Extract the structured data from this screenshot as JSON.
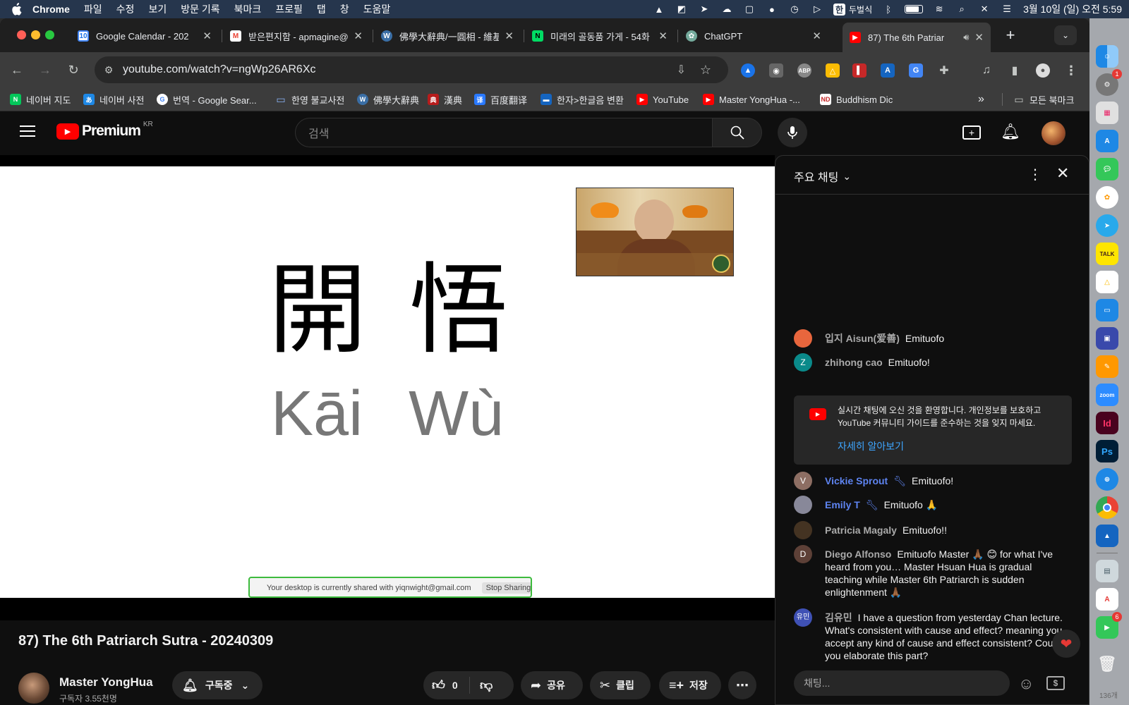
{
  "menubar": {
    "app": "Chrome",
    "items": [
      "파일",
      "수정",
      "보기",
      "방문 기록",
      "북마크",
      "프로필",
      "탭",
      "창",
      "도움말"
    ],
    "input_mode": "한",
    "input_name": "두벌식",
    "clock": "3월 10일 (일) 오전 5:59"
  },
  "tabs": [
    {
      "title": "Google Calendar - 202",
      "favicon": "calendar-icon",
      "badge": "10"
    },
    {
      "title": "받은편지함 - apmagine@",
      "favicon": "gmail-icon"
    },
    {
      "title": "佛學大辭典/一圓相 - 維基",
      "favicon": "wiki-icon"
    },
    {
      "title": "미래의 골동품 가게 - 54화",
      "favicon": "webtoon-icon"
    },
    {
      "title": "ChatGPT",
      "favicon": "chatgpt-icon"
    },
    {
      "title": "87) The 6th Patriar",
      "favicon": "youtube-icon",
      "active": true
    }
  ],
  "address": "youtube.com/watch?v=ngWp26AR6Xc",
  "bookmarks": [
    {
      "label": "네이버 지도"
    },
    {
      "label": "네이버 사전"
    },
    {
      "label": "번역 - Google Sear..."
    },
    {
      "label": "한영 불교사전"
    },
    {
      "label": "佛學大辭典"
    },
    {
      "label": "漢典"
    },
    {
      "label": "百度翻译"
    },
    {
      "label": "한자>한글음 변환"
    },
    {
      "label": "YouTube"
    },
    {
      "label": "Master YongHua -..."
    },
    {
      "label": "Buddhism Dic"
    }
  ],
  "bookmarks_all": "모든 북마크",
  "youtube": {
    "logo_text": "Premium",
    "region": "KR",
    "search_placeholder": "검색"
  },
  "slide": {
    "chars": "開悟",
    "pinyin": "Kāi Wù",
    "share_notice": "Your desktop is currently shared with yiqnwight@gmail.com",
    "stop_sharing": "Stop Sharing"
  },
  "video": {
    "title": "87) The 6th Patriarch Sutra - 20240309",
    "channel": "Master YongHua",
    "subscribers": "구독자 3.55천명",
    "subscribed_label": "구독중",
    "likes": "0",
    "share_label": "공유",
    "clip_label": "클립",
    "save_label": "저장"
  },
  "chat": {
    "header": "주요 채팅",
    "notice_text": "실시간 채팅에 오신 것을 환영합니다. 개인정보를 보호하고 YouTube 커뮤니티 가이드를 준수하는 것을 잊지 마세요.",
    "notice_link": "자세히 알아보기",
    "input_placeholder": "채팅...",
    "messages": [
      {
        "author": "입지 Aisun(爱善)",
        "text": "Emituofo",
        "avatar": "",
        "color": "#e8663d",
        "mod": false
      },
      {
        "author": "zhihong cao",
        "text": "Emituofo!",
        "avatar": "Z",
        "color": "#0a8a8a",
        "mod": false
      },
      {
        "author": "Vickie Sprout",
        "text": "Emituofo!",
        "avatar": "V",
        "color": "#8d6e63",
        "mod": true
      },
      {
        "author": "Emily T",
        "text": "Emituofo 🙏",
        "avatar": "",
        "color": "#889",
        "mod": true
      },
      {
        "author": "Patricia Magaly",
        "text": "Emituofo!!",
        "avatar": "",
        "color": "#432",
        "mod": false
      },
      {
        "author": "Diego Alfonso",
        "text": "Emituofo Master 🙏🏾 😊 for what I've heard from you… Master Hsuan Hua is gradual teaching while Master 6th Patriarch is sudden enlightenment 🙏🏾",
        "avatar": "D",
        "color": "#5d4037",
        "mod": false
      },
      {
        "author": "김유민",
        "text": "I have a question from yesterday Chan lecture. What's consistent with cause and effect? meaning you accept any kind of cause and effect consistent? Could you elaborate this part?",
        "avatar": "유민",
        "color": "#3f51b5",
        "mod": false
      }
    ]
  },
  "dock": {
    "badge_settings": "1",
    "badge_facetime": "6",
    "trash_count": "136개"
  }
}
